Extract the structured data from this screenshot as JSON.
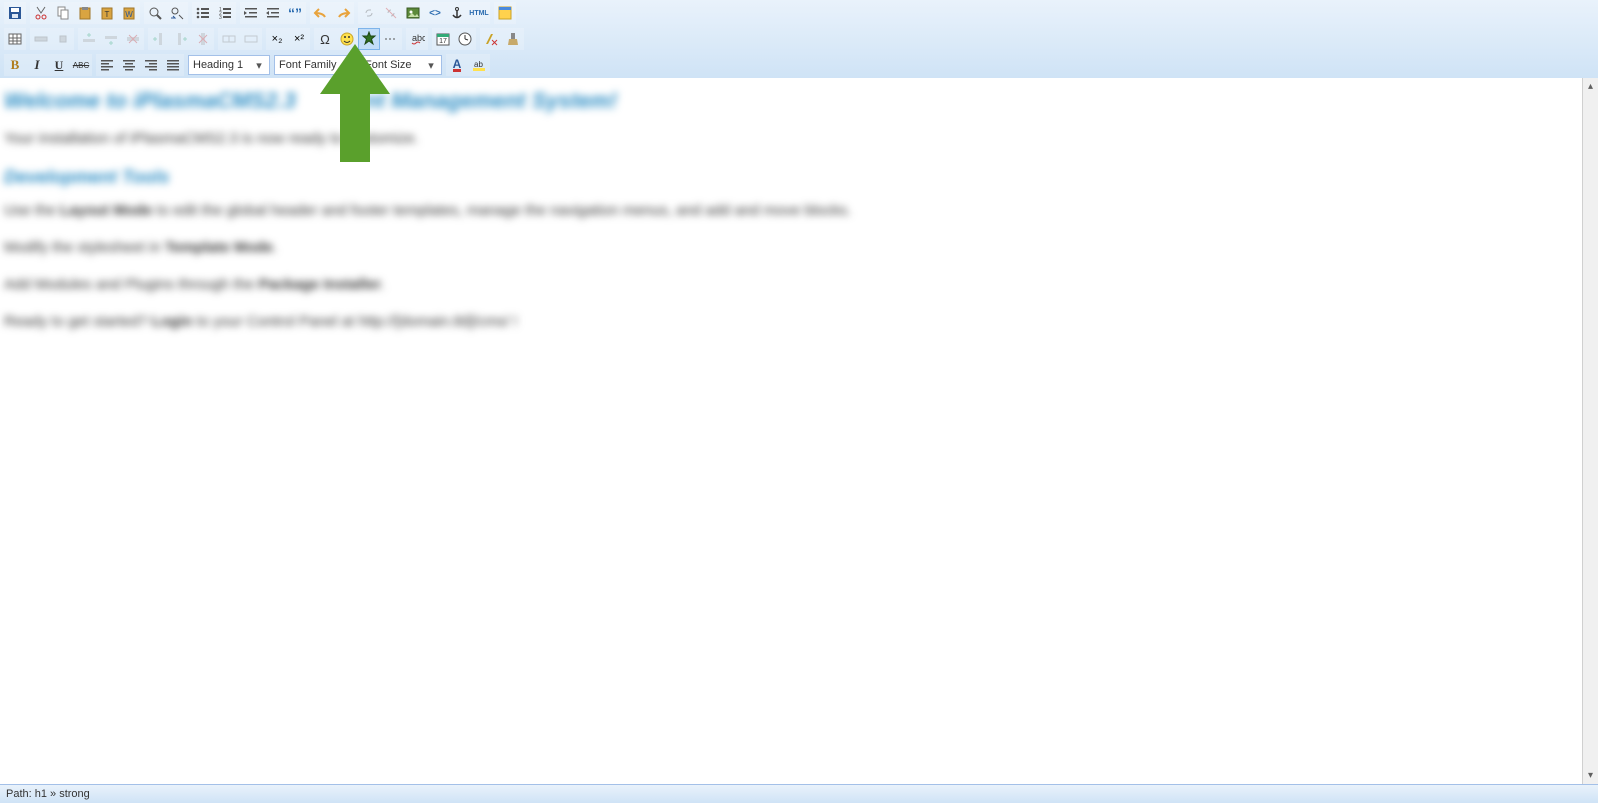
{
  "dropdowns": {
    "heading": "Heading 1",
    "fontFamily": "Font Family",
    "fontSize": "Font Size"
  },
  "statusbar": {
    "path": "Path: h1 » strong"
  },
  "icons": {
    "bold": "B",
    "italic": "I",
    "underline": "U",
    "strike": "ABC",
    "sub": "×₂",
    "sup": "×²",
    "omega": "Ω",
    "foreColor": "A",
    "html": "HTML"
  },
  "content": {
    "h1_pre": "Welcome to iPlasmaCMS2.3 ",
    "h1_post": "nt Management System!",
    "p1": "Your installation of iPlasmaCMS2.3 is now ready to customize.",
    "h2": "Development Tools",
    "p2_a": "Use the ",
    "p2_b": "Layout Mode",
    "p2_c": " to edit the global header and footer templates, manage the navigation menus, and add and move blocks.",
    "p3_a": "Modify the stylesheet in ",
    "p3_b": "Template Mode",
    "p3_c": ".",
    "p4_a": "Add Modules and Plugins through the ",
    "p4_b": "Package Installer",
    "p4_c": ".",
    "p5_a": "Ready to get started?  ",
    "p5_b": "Login",
    "p5_c": " to your Control Panel at http://[domain.tld]/cms/ !"
  },
  "colors": {
    "accent": "#5aa02c",
    "toolbarBg": "#cfe3f6",
    "linkBlue": "#2a8cc4"
  }
}
